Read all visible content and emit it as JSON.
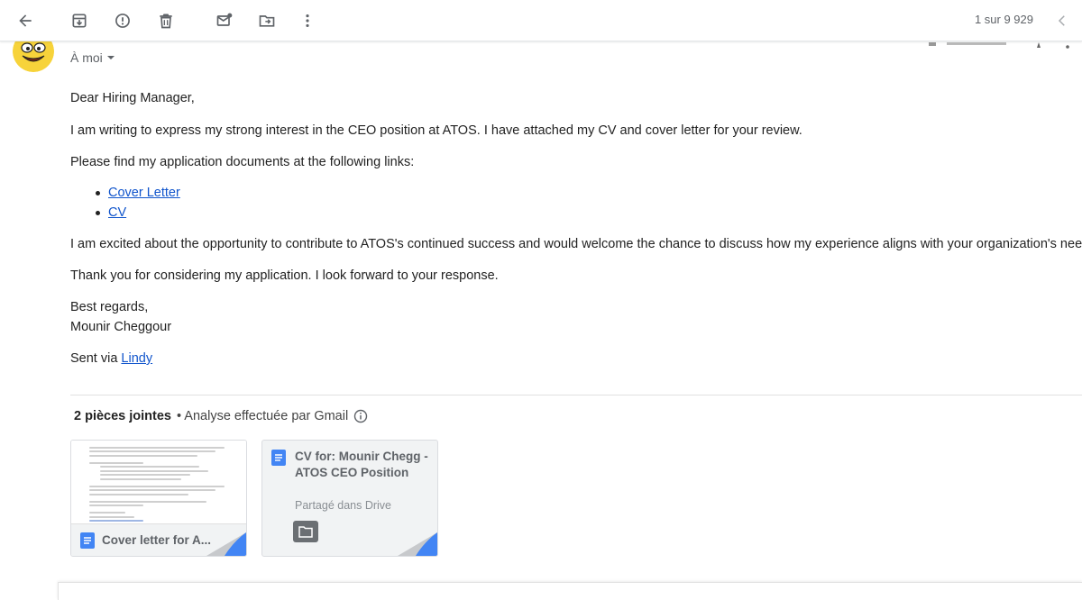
{
  "toolbar": {
    "pager_text": "1 sur 9 929"
  },
  "icons": {
    "back": "arrow-left-icon",
    "archive": "archive-icon",
    "report_spam": "report-icon",
    "delete": "trash-icon",
    "mark_unread": "mark-unread-icon",
    "move_to": "move-to-icon",
    "more": "more-vertical-icon",
    "older": "chevron-left-icon"
  },
  "header": {
    "recipient": "À moi"
  },
  "message": {
    "greeting": "Dear Hiring Manager,",
    "intro": "I am writing to express my strong interest in the CEO position at ATOS. I have attached my CV and cover letter for your review.",
    "links_intro": "Please find my application documents at the following links:",
    "links": [
      "Cover Letter",
      "CV"
    ],
    "excited": "I am excited about the opportunity to contribute to ATOS's continued success and would welcome the chance to discuss how my experience aligns with your organization's needs.",
    "thanks": "Thank you for considering my application. I look forward to your response.",
    "regards": "Best regards,",
    "name": "Mounir Cheggour",
    "sent_via_prefix": "Sent via ",
    "sent_via_link": "Lindy"
  },
  "attachments": {
    "count_label": "2 pièces jointes",
    "scan_label": "• Analyse effectuée par Gmail",
    "cards": [
      {
        "name": "Cover letter for A..."
      },
      {
        "title": "CV for: Mounir Chegg      - ATOS CEO Position",
        "subtitle": "Partagé dans Drive"
      }
    ]
  },
  "colors": {
    "link": "#1155cc",
    "doc_blue": "#4285f4",
    "icon_grey": "#5f6368"
  }
}
